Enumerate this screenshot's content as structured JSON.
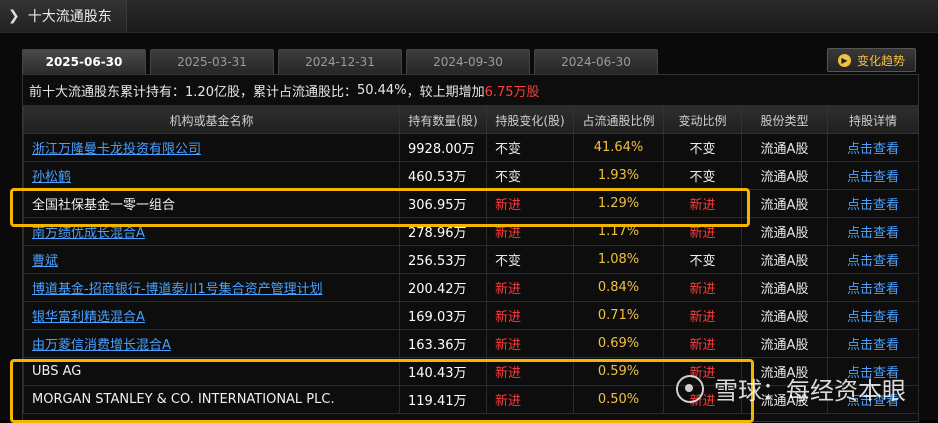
{
  "header": {
    "title": "十大流通股东"
  },
  "tabs": [
    {
      "label": "2025-06-30",
      "active": true
    },
    {
      "label": "2025-03-31",
      "active": false
    },
    {
      "label": "2024-12-31",
      "active": false
    },
    {
      "label": "2024-09-30",
      "active": false
    },
    {
      "label": "2024-06-30",
      "active": false
    }
  ],
  "trend_button": "变化趋势",
  "summary": {
    "part1": "前十大流通股东累计持有：",
    "holding": "1.20亿股",
    "part2": "，累计占流通股比：",
    "ratio": "50.44%",
    "part3": "，较上期增加",
    "increase": "6.75万股"
  },
  "columns": [
    "机构或基金名称",
    "持有数量(股)",
    "持股变化(股)",
    "占流通股比例",
    "变动比例",
    "股份类型",
    "持股详情"
  ],
  "rows": [
    {
      "name": "浙江万隆曼卡龙投资有限公司",
      "link": true,
      "hold": "9928.00万",
      "change": "不变",
      "pct": "41.64%",
      "ratio": "不变",
      "type": "流通A股",
      "detail": "点击查看"
    },
    {
      "name": "孙松鹤",
      "link": true,
      "hold": "460.53万",
      "change": "不变",
      "pct": "1.93%",
      "ratio": "不变",
      "type": "流通A股",
      "detail": "点击查看"
    },
    {
      "name": "全国社保基金一零一组合",
      "link": false,
      "hold": "306.95万",
      "change": "新进",
      "pct": "1.29%",
      "ratio": "新进",
      "type": "流通A股",
      "detail": "点击查看"
    },
    {
      "name": "南方绩优成长混合A",
      "link": true,
      "hold": "278.96万",
      "change": "新进",
      "pct": "1.17%",
      "ratio": "新进",
      "type": "流通A股",
      "detail": "点击查看"
    },
    {
      "name": "曹斌",
      "link": true,
      "hold": "256.53万",
      "change": "不变",
      "pct": "1.08%",
      "ratio": "不变",
      "type": "流通A股",
      "detail": "点击查看"
    },
    {
      "name": "博道基金-招商银行-博道泰川1号集合资产管理计划",
      "link": true,
      "hold": "200.42万",
      "change": "新进",
      "pct": "0.84%",
      "ratio": "新进",
      "type": "流通A股",
      "detail": "点击查看"
    },
    {
      "name": "银华富利精选混合A",
      "link": true,
      "hold": "169.03万",
      "change": "新进",
      "pct": "0.71%",
      "ratio": "新进",
      "type": "流通A股",
      "detail": "点击查看"
    },
    {
      "name": "由万菱信消费增长混合A",
      "link": true,
      "hold": "163.36万",
      "change": "新进",
      "pct": "0.69%",
      "ratio": "新进",
      "type": "流通A股",
      "detail": "点击查看"
    },
    {
      "name": "UBS AG",
      "link": false,
      "hold": "140.43万",
      "change": "新进",
      "pct": "0.59%",
      "ratio": "新进",
      "type": "流通A股",
      "detail": "点击查看"
    },
    {
      "name": "MORGAN STANLEY & CO. INTERNATIONAL PLC.",
      "link": false,
      "hold": "119.41万",
      "change": "新进",
      "pct": "0.50%",
      "ratio": "新进",
      "type": "流通A股",
      "detail": "点击查看"
    }
  ],
  "watermark": "雪球：每经资本眼",
  "colors": {
    "accent": "#f5b400",
    "link": "#4aa0ff",
    "red": "#ff3b3b",
    "gold": "#f0c040"
  }
}
